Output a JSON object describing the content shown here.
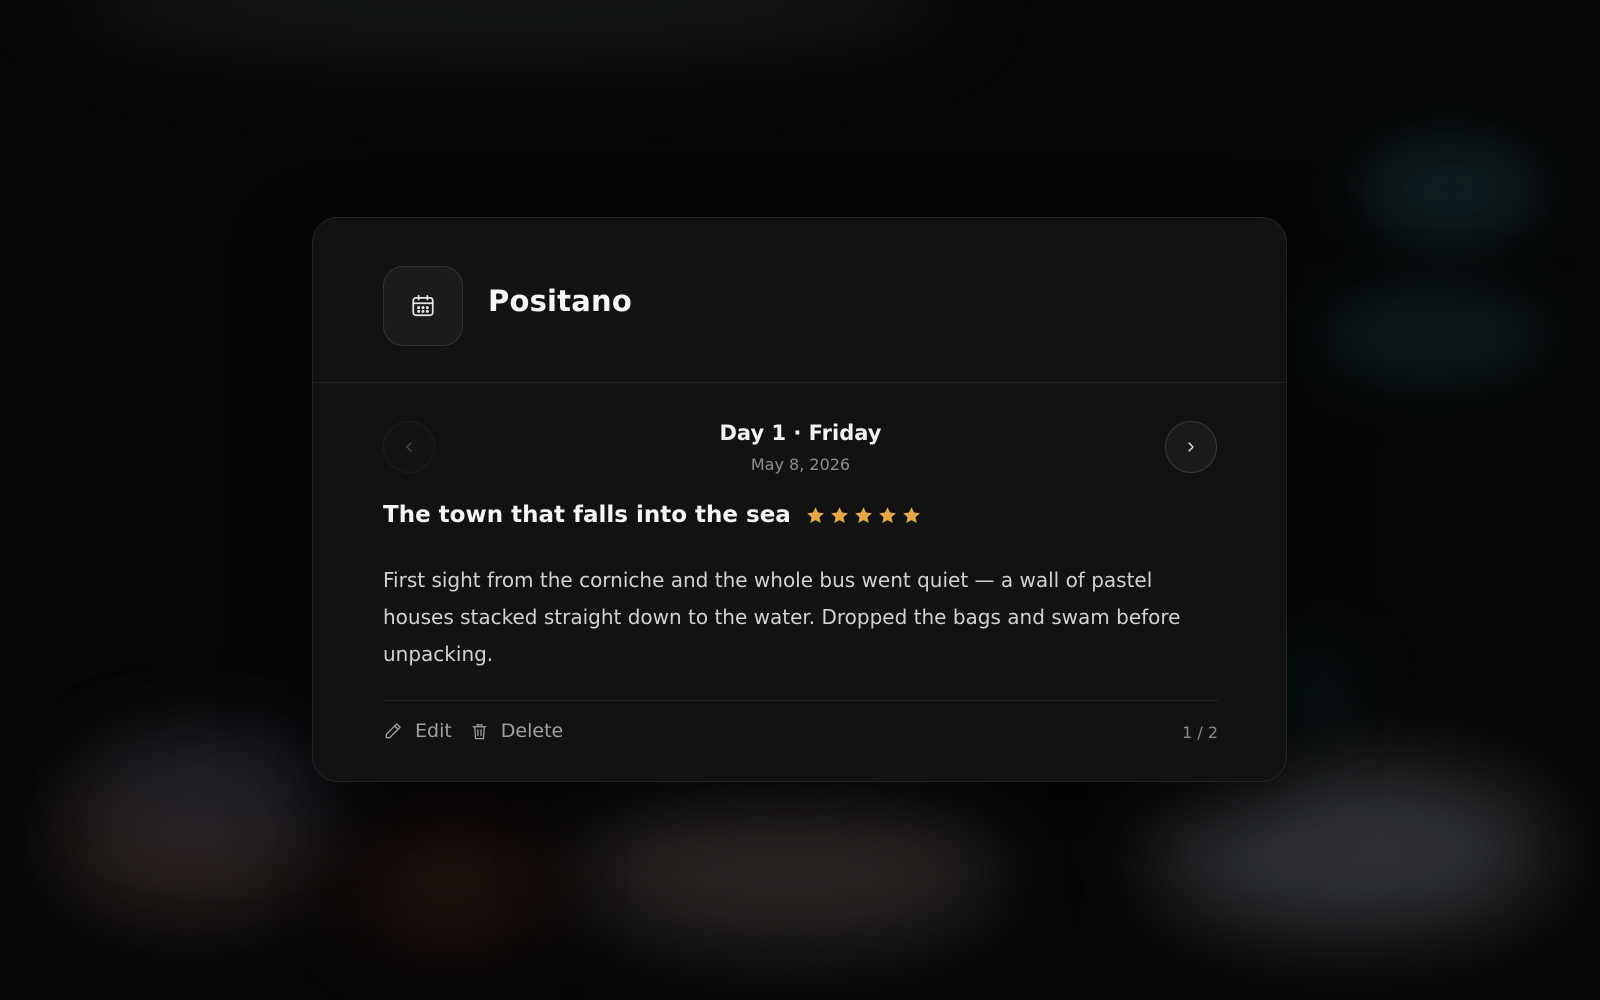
{
  "card": {
    "title": "Positano",
    "icon": "calendar-icon"
  },
  "day": {
    "title": "Day 1 · Friday",
    "date": "May 8, 2026",
    "prev_icon": "chevron-left-icon",
    "next_icon": "chevron-right-icon"
  },
  "entry": {
    "title": "The town that falls into the sea",
    "rating": 5,
    "rating_max": 5,
    "star_color": "#E5A94A",
    "body": "First sight from the corniche and the whole bus went quiet — a wall of pastel houses stacked straight down to the water. Dropped the bags and swam before unpacking."
  },
  "actions": {
    "edit_label": "Edit",
    "edit_icon": "pencil-icon",
    "delete_label": "Delete",
    "delete_icon": "trash-icon"
  },
  "pagination": {
    "label": "1 / 2"
  }
}
